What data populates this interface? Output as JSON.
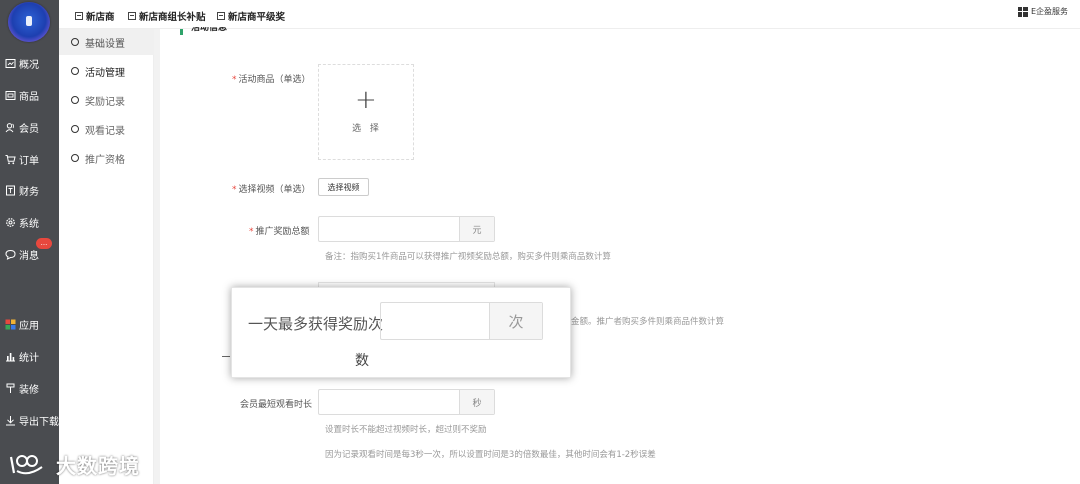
{
  "top_tabs": [
    "新店商",
    "新店商组长补贴",
    "新店商平级奖"
  ],
  "service_label": "E企盈服务",
  "sidebar": {
    "items": [
      {
        "label": "概况",
        "icon": "dashboard-icon"
      },
      {
        "label": "商品",
        "icon": "goods-icon"
      },
      {
        "label": "会员",
        "icon": "member-icon"
      },
      {
        "label": "订单",
        "icon": "cart-icon"
      },
      {
        "label": "财务",
        "icon": "finance-icon"
      },
      {
        "label": "系统",
        "icon": "gear-icon"
      },
      {
        "label": "消息",
        "icon": "message-icon"
      },
      {
        "label": "应用",
        "icon": "apps-icon"
      },
      {
        "label": "统计",
        "icon": "chart-icon"
      },
      {
        "label": "装修",
        "icon": "brush-icon"
      },
      {
        "label": "导出下载",
        "icon": "download-icon"
      }
    ],
    "message_badge": "..."
  },
  "subnav": {
    "items": [
      "基础设置",
      "活动管理",
      "奖励记录",
      "观看记录",
      "推广资格"
    ]
  },
  "section_title": "活动信息",
  "form": {
    "product_label": "活动商品（单选）",
    "select_text": "选 择",
    "video_label": "选择视频（单选）",
    "video_button": "选择视频",
    "reward_total_label": "推广奖励总额",
    "reward_total_unit": "元",
    "reward_note": "备注：指购买1件商品可以获得推广视频奖励总额，购买多件则乘商品数计算",
    "partial_note": "金额。推广者购买多件则乘商品件数计算",
    "watch_time_label": "会员最短观看时长",
    "watch_time_unit": "秒",
    "watch_note_1": "设置时长不能超过视频时长，超过则不奖励",
    "watch_note_2": "因为记录观看时间是每3秒一次，所以设置时间是3的倍数最佳，其他时间会有1-2秒误差"
  },
  "zoom": {
    "label": "一天最多获得奖励次",
    "label_cont": "数",
    "unit": "次"
  },
  "watermark": "大数跨境",
  "colors": {
    "sidebar_bg": "#4a4c50",
    "required": "#e8483e",
    "accent": "#2ea36a"
  }
}
